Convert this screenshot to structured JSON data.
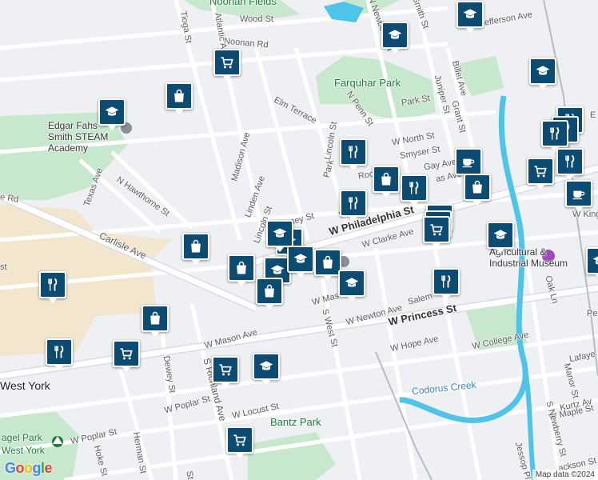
{
  "map": {
    "colors": {
      "land": "#eef0f3",
      "park": "#c7e8cc",
      "campus": "#f3e6cf",
      "water": "#4fc3e8",
      "road": "#ffffff",
      "major_road": "#d9dde3",
      "rail": "#b7bcc4",
      "marker": "#0d4c72"
    },
    "labels": [
      {
        "text": "Noonan Fields",
        "kind": "park"
      },
      {
        "text": "Wood St",
        "kind": "road"
      },
      {
        "text": "Noonan Rd",
        "kind": "road"
      },
      {
        "text": "Tioga St",
        "kind": "road"
      },
      {
        "text": "Atlantic Ave",
        "kind": "road"
      },
      {
        "text": "N Newberry St",
        "kind": "road"
      },
      {
        "text": "Smith St",
        "kind": "road"
      },
      {
        "text": "Jefferson Ave",
        "kind": "road"
      },
      {
        "text": "Farquhar Park",
        "kind": "park"
      },
      {
        "text": "Billet Ave",
        "kind": "road"
      },
      {
        "text": "Juniper St",
        "kind": "road"
      },
      {
        "text": "Grant St",
        "kind": "road"
      },
      {
        "text": "Park St",
        "kind": "road"
      },
      {
        "text": "Elm Terrace",
        "kind": "road"
      },
      {
        "text": "N Penn St",
        "kind": "road"
      },
      {
        "text": "Edgar Fahs Smith STEAM Academy",
        "kind": "poi"
      },
      {
        "text": "W North St",
        "kind": "road"
      },
      {
        "text": "Lincoln St",
        "kind": "road"
      },
      {
        "text": "Madison Ave",
        "kind": "road"
      },
      {
        "text": "Smyser St",
        "kind": "road"
      },
      {
        "text": "Park",
        "kind": "road"
      },
      {
        "text": "Roo",
        "kind": "road"
      },
      {
        "text": "Gay Ave",
        "kind": "road"
      },
      {
        "text": "as Ave",
        "kind": "road"
      },
      {
        "text": "E",
        "kind": "road"
      },
      {
        "text": "Texas Ave",
        "kind": "road"
      },
      {
        "text": "N Hawthorne St",
        "kind": "road"
      },
      {
        "text": "Linden Ave",
        "kind": "road"
      },
      {
        "text": "e Rd",
        "kind": "road"
      },
      {
        "text": "W",
        "kind": "road"
      },
      {
        "text": "W Philadelphia St",
        "kind": "major"
      },
      {
        "text": "W King",
        "kind": "road"
      },
      {
        "text": "Lincoln St",
        "kind": "road"
      },
      {
        "text": "Co",
        "kind": "road"
      },
      {
        "text": "ney St",
        "kind": "road"
      },
      {
        "text": "W Clarke Ave",
        "kind": "road"
      },
      {
        "text": "Carlisle Ave",
        "kind": "road"
      },
      {
        "text": "Agricultural & Industrial Museum",
        "kind": "poi"
      },
      {
        "text": "Oak Ln",
        "kind": "road"
      },
      {
        "text": "W Mas",
        "kind": "road"
      },
      {
        "text": "S West St",
        "kind": "road"
      },
      {
        "text": "W Newton Ave",
        "kind": "road"
      },
      {
        "text": "Salem",
        "kind": "road"
      },
      {
        "text": "W Princess St",
        "kind": "major"
      },
      {
        "text": "Pe",
        "kind": "road"
      },
      {
        "text": "W Mason Ave",
        "kind": "road"
      },
      {
        "text": "W Hope Ave",
        "kind": "road"
      },
      {
        "text": "W College Ave",
        "kind": "road"
      },
      {
        "text": "Lafaye",
        "kind": "road"
      },
      {
        "text": "Dewey St",
        "kind": "road"
      },
      {
        "text": "S Richland Ave",
        "kind": "road"
      },
      {
        "text": "West York",
        "kind": "place"
      },
      {
        "text": "Codorus Creek",
        "kind": "water"
      },
      {
        "text": "Manor St",
        "kind": "road"
      },
      {
        "text": "Kurtz Av",
        "kind": "road"
      },
      {
        "text": "W Maple St",
        "kind": "road"
      },
      {
        "text": "W Poplar St",
        "kind": "road"
      },
      {
        "text": "W Locust St",
        "kind": "road"
      },
      {
        "text": "S Newberry St",
        "kind": "road"
      },
      {
        "text": "Bantz Park",
        "kind": "park"
      },
      {
        "text": "agel Park",
        "kind": "park"
      },
      {
        "text": "West York",
        "kind": "park"
      },
      {
        "text": "W Poplar St",
        "kind": "road"
      },
      {
        "text": "Herman St",
        "kind": "road"
      },
      {
        "text": "Hoke St",
        "kind": "road"
      },
      {
        "text": "Jessop Pl",
        "kind": "road"
      },
      {
        "text": "ackson St",
        "kind": "road"
      },
      {
        "text": "st",
        "kind": "road"
      },
      {
        "text": "St",
        "kind": "road"
      }
    ],
    "markers": [
      {
        "icon": "school-icon"
      },
      {
        "icon": "school-icon"
      },
      {
        "icon": "cart-icon"
      },
      {
        "icon": "school-icon"
      },
      {
        "icon": "bag-icon"
      },
      {
        "icon": "school-icon"
      },
      {
        "icon": "restaurant-icon"
      },
      {
        "icon": "bag-icon"
      },
      {
        "icon": "restaurant-icon"
      },
      {
        "icon": "coffee-icon"
      },
      {
        "icon": "bag-icon"
      },
      {
        "icon": "restaurant-icon"
      },
      {
        "icon": "restaurant-icon"
      },
      {
        "icon": "restaurant-icon"
      },
      {
        "icon": "restaurant-icon"
      },
      {
        "icon": "restaurant-icon"
      },
      {
        "icon": "cart-icon"
      },
      {
        "icon": "coffee-icon"
      },
      {
        "icon": "cart-icon"
      },
      {
        "icon": "cart-icon"
      },
      {
        "icon": "cart-icon"
      },
      {
        "icon": "school-icon"
      },
      {
        "icon": "bag-icon"
      },
      {
        "icon": "school-icon"
      },
      {
        "icon": "bag-icon"
      },
      {
        "icon": "school-icon"
      },
      {
        "icon": "school-icon"
      },
      {
        "icon": "bag-icon"
      },
      {
        "icon": "bag-icon"
      },
      {
        "icon": "school-icon"
      },
      {
        "icon": "restaurant-icon"
      },
      {
        "icon": "school-icon"
      },
      {
        "icon": "restaurant-icon"
      },
      {
        "icon": "bag-icon"
      },
      {
        "icon": "restaurant-icon"
      },
      {
        "icon": "cart-icon"
      },
      {
        "icon": "school-icon"
      },
      {
        "icon": "cart-icon"
      },
      {
        "icon": "cart-icon"
      },
      {
        "icon": "school-icon"
      }
    ],
    "logo": {
      "letters": [
        "G",
        "o",
        "o",
        "g",
        "l",
        "e"
      ],
      "colors": [
        "#4285F4",
        "#EA4335",
        "#FBBC05",
        "#4285F4",
        "#34A853",
        "#EA4335"
      ]
    },
    "attribution": "Map data ©2024"
  }
}
